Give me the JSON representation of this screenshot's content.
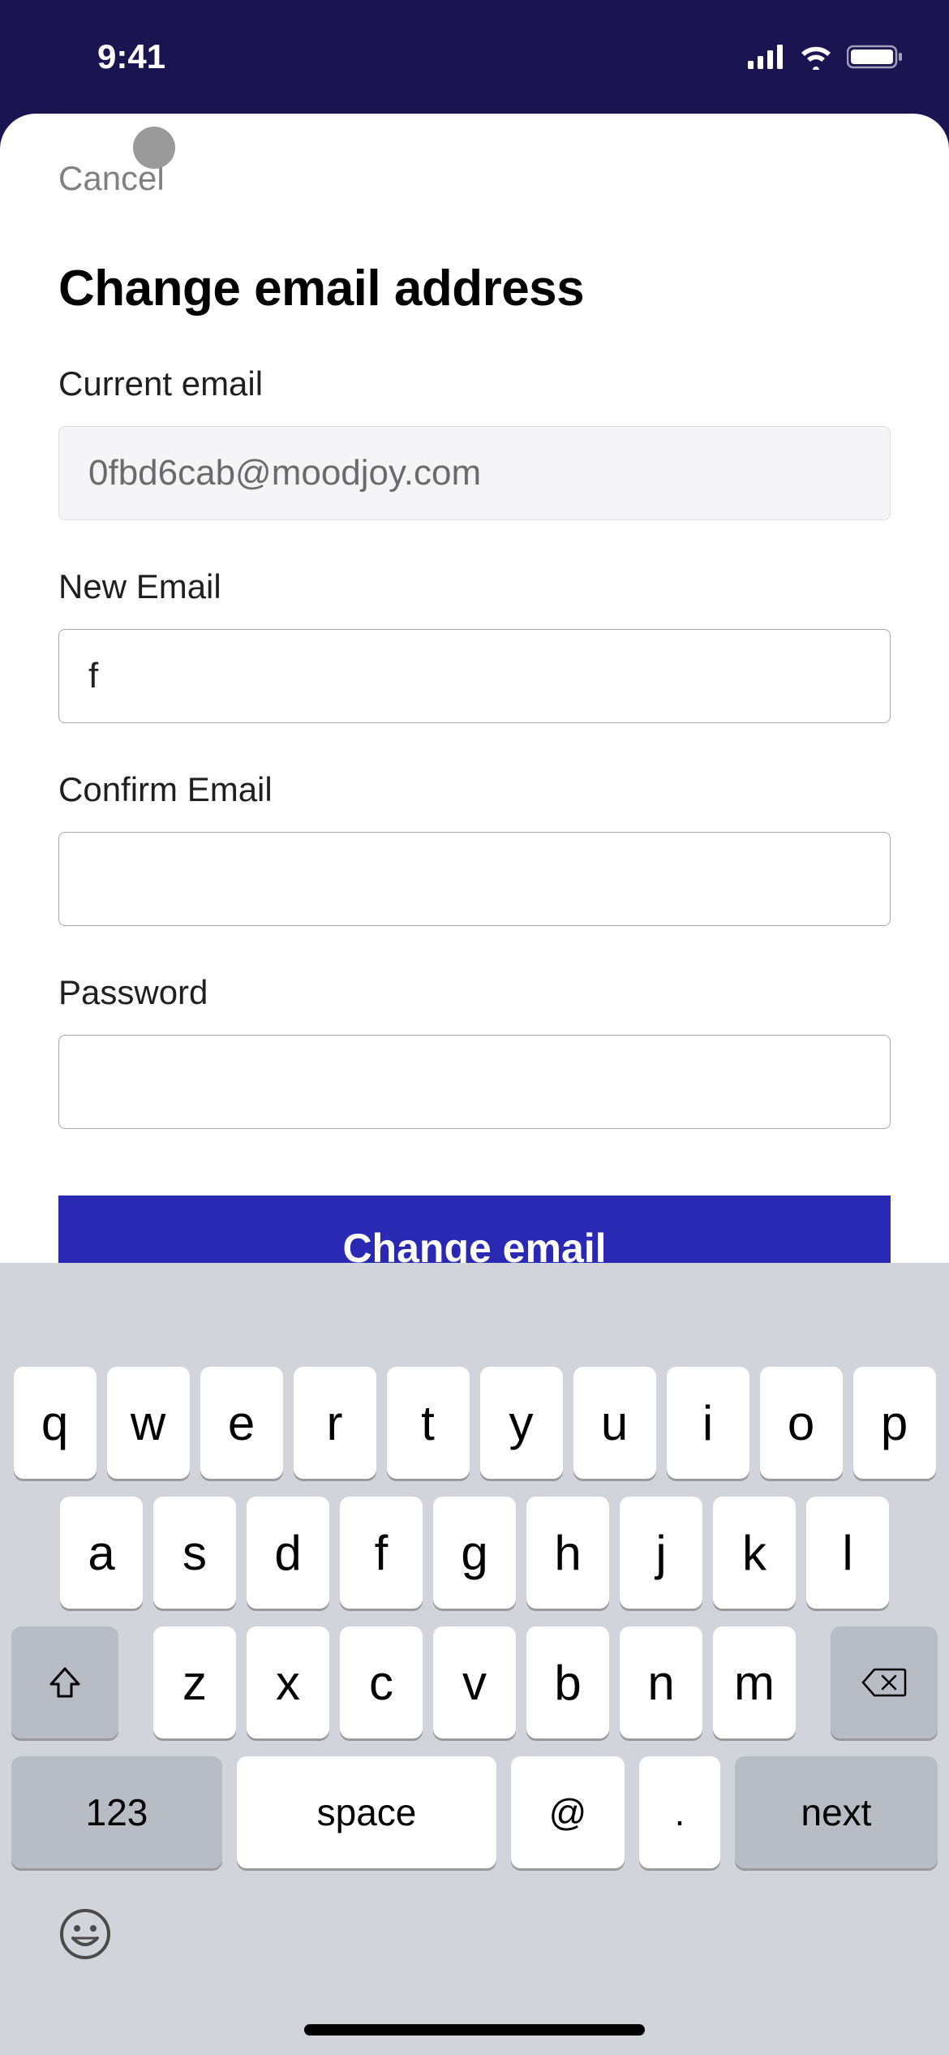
{
  "statusbar": {
    "time": "9:41"
  },
  "sheet": {
    "cancel": "Cancel",
    "title": "Change email address",
    "current_email": {
      "label": "Current email",
      "value": "0fbd6cab@moodjoy.com"
    },
    "new_email": {
      "label": "New Email",
      "value": "f"
    },
    "confirm_email": {
      "label": "Confirm Email",
      "value": ""
    },
    "password": {
      "label": "Password",
      "value": ""
    },
    "submit": "Change email"
  },
  "keyboard": {
    "row1": [
      "q",
      "w",
      "e",
      "r",
      "t",
      "y",
      "u",
      "i",
      "o",
      "p"
    ],
    "row2": [
      "a",
      "s",
      "d",
      "f",
      "g",
      "h",
      "j",
      "k",
      "l"
    ],
    "row3": [
      "z",
      "x",
      "c",
      "v",
      "b",
      "n",
      "m"
    ],
    "key123": "123",
    "space": "space",
    "at": "@",
    "dot": ".",
    "next": "next"
  }
}
